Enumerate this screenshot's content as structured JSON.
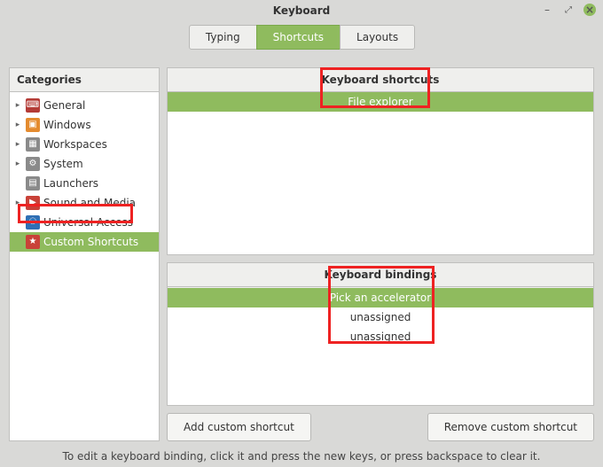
{
  "window": {
    "title": "Keyboard"
  },
  "tabs": {
    "typing": "Typing",
    "shortcuts": "Shortcuts",
    "layouts": "Layouts"
  },
  "sidebar": {
    "header": "Categories",
    "items": [
      {
        "label": "General"
      },
      {
        "label": "Windows"
      },
      {
        "label": "Workspaces"
      },
      {
        "label": "System"
      },
      {
        "label": "Launchers"
      },
      {
        "label": "Sound and Media"
      },
      {
        "label": "Universal Access"
      },
      {
        "label": "Custom Shortcuts"
      }
    ]
  },
  "shortcuts": {
    "header": "Keyboard shortcuts",
    "rows": [
      "File explorer"
    ]
  },
  "bindings": {
    "header": "Keyboard bindings",
    "rows": [
      "Pick an accelerator",
      "unassigned",
      "unassigned"
    ]
  },
  "buttons": {
    "add": "Add custom shortcut",
    "remove": "Remove custom shortcut"
  },
  "footer": "To edit a keyboard binding, click it and press the new keys, or press backspace to clear it."
}
